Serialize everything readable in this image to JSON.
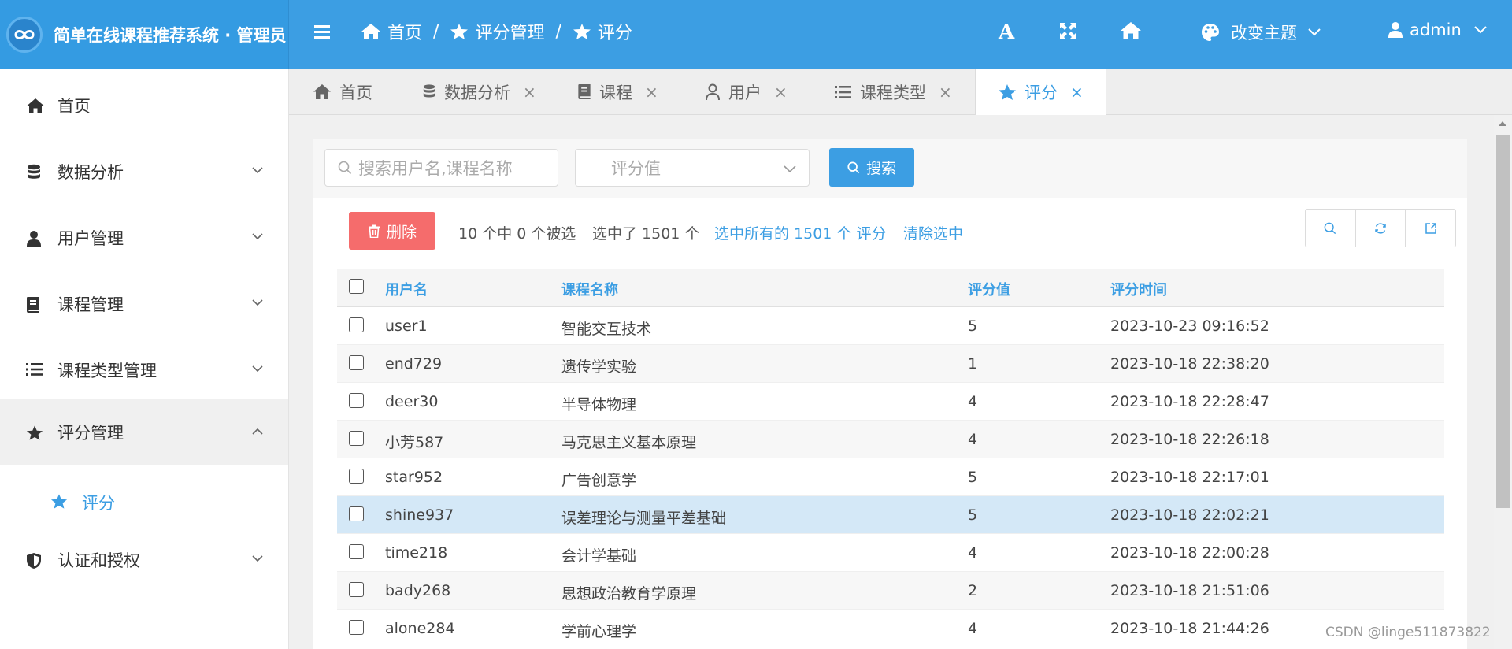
{
  "app": {
    "title": "简单在线课程推荐系统 · 管理员"
  },
  "header": {
    "breadcrumb": [
      "首页",
      "评分管理",
      "评分"
    ],
    "breadcrumb_sep": "/",
    "font_btn": "A",
    "theme_label": "改变主题",
    "user_label": "admin"
  },
  "sidebar": {
    "items": [
      {
        "label": "首页",
        "icon": "home-icon"
      },
      {
        "label": "数据分析",
        "icon": "database-icon"
      },
      {
        "label": "用户管理",
        "icon": "user-icon"
      },
      {
        "label": "课程管理",
        "icon": "book-icon"
      },
      {
        "label": "课程类型管理",
        "icon": "list-icon"
      },
      {
        "label": "评分管理",
        "icon": "star-icon"
      },
      {
        "label": "认证和授权",
        "icon": "shield-icon"
      }
    ],
    "sub_item": "评分"
  },
  "tabs": [
    {
      "label": "首页"
    },
    {
      "label": "数据分析"
    },
    {
      "label": "课程"
    },
    {
      "label": "用户"
    },
    {
      "label": "课程类型"
    },
    {
      "label": "评分"
    }
  ],
  "tab_close": "×",
  "search": {
    "keyword_placeholder": "搜索用户名,课程名称",
    "rating_placeholder": "评分值",
    "button": "搜索"
  },
  "toolbar": {
    "delete": "删除",
    "selected_count": "10 个中 0 个被选",
    "selected_total": "选中了 1501 个",
    "select_all": "选中所有的 1501 个 评分",
    "clear": "清除选中"
  },
  "table": {
    "columns": [
      "用户名",
      "课程名称",
      "评分值",
      "评分时间"
    ],
    "rows": [
      [
        "user1",
        "智能交互技术",
        "5",
        "2023-10-23 09:16:52"
      ],
      [
        "end729",
        "遗传学实验",
        "1",
        "2023-10-18 22:38:20"
      ],
      [
        "deer30",
        "半导体物理",
        "4",
        "2023-10-18 22:28:47"
      ],
      [
        "小芳587",
        "马克思主义基本原理",
        "4",
        "2023-10-18 22:26:18"
      ],
      [
        "star952",
        "广告创意学",
        "5",
        "2023-10-18 22:17:01"
      ],
      [
        "shine937",
        "误差理论与测量平差基础",
        "5",
        "2023-10-18 22:02:21"
      ],
      [
        "time218",
        "会计学基础",
        "4",
        "2023-10-18 22:00:28"
      ],
      [
        "bady268",
        "思想政治教育学原理",
        "2",
        "2023-10-18 21:51:06"
      ],
      [
        "alone284",
        "学前心理学",
        "4",
        "2023-10-18 21:44:26"
      ]
    ]
  },
  "watermark": "CSDN @linge511873822",
  "colors": {
    "primary": "#3c9ee3",
    "danger": "#f56c6c",
    "selected_row": "#d4e8f7"
  }
}
